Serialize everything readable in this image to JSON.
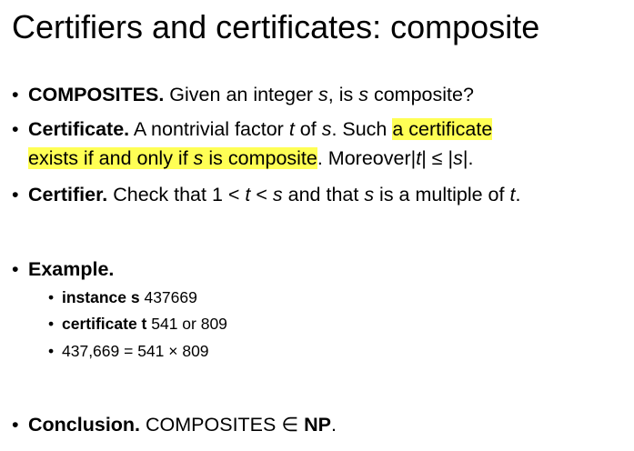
{
  "title": "Certifiers and certificates: composite",
  "bullets": {
    "composites": {
      "label": "COMPOSITES.",
      "text1": " Given an integer ",
      "var1": "s",
      "text2": ", is ",
      "var2": "s",
      "text3": " composite?"
    },
    "certificate": {
      "label": "Certificate.",
      "text1": " A nontrivial factor ",
      "var1": "t",
      "text2": " of ",
      "var2": "s",
      "text3": ". Such ",
      "highlight1": "a certificate",
      "highlight2a": "exists if and only if ",
      "highlight2var": "s",
      "highlight2b": " is composite",
      "text4": ". Moreover",
      "abs_t_open": "|",
      "abs_t": "t",
      "abs_t_close": "|",
      "leq": " ≤ ",
      "abs_s_open": "|",
      "abs_s": "s",
      "abs_s_close": "|",
      "end": "."
    },
    "certifier": {
      "label": "Certifier.",
      "text1": " Check that 1 < ",
      "var1": "t",
      "text2": " < ",
      "var2": "s",
      "text3": " and that ",
      "var3": "s",
      "text4": " is a multiple of ",
      "var4": "t",
      "end": "."
    },
    "example": {
      "label": "Example.",
      "items": [
        {
          "label": "instance s",
          "value": " 437669"
        },
        {
          "label": "certificate t",
          "value": " 541 or 809"
        },
        {
          "label": "",
          "value": "437,669 = 541 × 809"
        }
      ]
    },
    "conclusion": {
      "label": "Conclusion.",
      "text1": " COMPOSITES ",
      "symbol": "∈",
      "text2": " ",
      "np": "NP",
      "end": "."
    }
  },
  "bullet_glyph": "•",
  "highlight_color": "#ffff55"
}
